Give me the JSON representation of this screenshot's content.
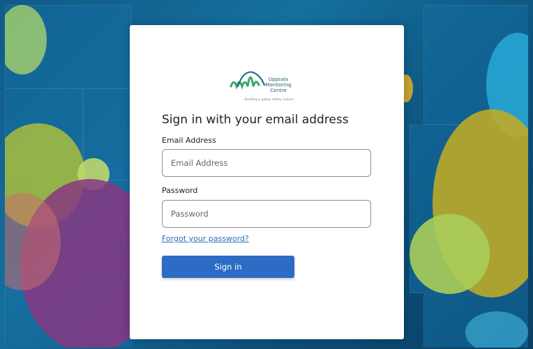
{
  "logo": {
    "line1": "Uppsala",
    "line2": "Monitoring",
    "line3": "Centre",
    "tagline": "– Building a global safety culture"
  },
  "form": {
    "heading": "Sign in with your email address",
    "email_label": "Email Address",
    "email_placeholder": "Email Address",
    "password_label": "Password",
    "password_placeholder": "Password",
    "forgot_link": "Forgot your password?",
    "signin_label": "Sign in"
  },
  "colors": {
    "button": "#2c6cc4",
    "link": "#2a6fb8",
    "logo_green": "#3aa86b",
    "logo_teal": "#1c6f86"
  }
}
